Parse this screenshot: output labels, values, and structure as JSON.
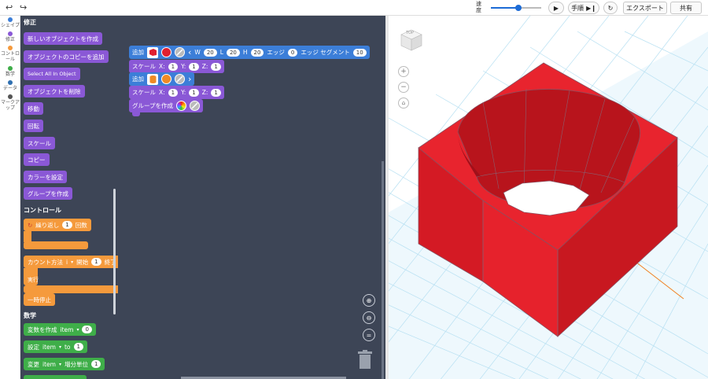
{
  "topbar": {
    "speed_label": "速度",
    "speed_value": 0.55,
    "play_icon": "play-icon",
    "step_label": "手順",
    "export_label": "エクスポート",
    "share_label": "共有"
  },
  "categories": [
    {
      "label": "シェイプ",
      "color": "#3c7ed8"
    },
    {
      "label": "修正",
      "color": "#8a58d6"
    },
    {
      "label": "コントロール",
      "color": "#f59a3c"
    },
    {
      "label": "数学",
      "color": "#3fae49"
    },
    {
      "label": "データ",
      "color": "#2f6fb0"
    },
    {
      "label": "マークアップ",
      "color": "#555555"
    }
  ],
  "palette": {
    "modify_header": "修正",
    "modify_blocks": [
      "新しいオブジェクトを作成",
      "オブジェクトのコピーを追加",
      "Select All In Object",
      "オブジェクトを削除",
      "移動",
      "回転",
      "スケール",
      "コピー",
      "カラーを設定",
      "グループを作成"
    ],
    "control_header": "コントロール",
    "repeat_label": "繰り返し",
    "repeat_count": "1",
    "repeat_unit": "回数",
    "count_label": "カウント方法",
    "count_var": "i",
    "count_start_label": "開始",
    "count_start": "1",
    "count_end_label": "終了",
    "count_do": "実行",
    "pause_label": "一時停止",
    "math_header": "数学",
    "var_create_label": "変数を作成",
    "var_create_name": "item",
    "var_create_value": "0",
    "set_label": "設定",
    "set_var": "item",
    "set_to": "to",
    "set_value": "1",
    "change_label": "変更",
    "change_var": "item",
    "change_unit": "増分単位",
    "change_value": "1"
  },
  "workspace": {
    "block1": {
      "label": "追加",
      "w_label": "W",
      "w": "20",
      "l_label": "L",
      "l": "20",
      "h_label": "H",
      "h": "20",
      "edge_label": "エッジ",
      "edge": "0",
      "seg_label": "エッジ セグメント",
      "seg": "10",
      "color": "#e02030"
    },
    "scale1": {
      "label": "スケール",
      "x_label": "X:",
      "x": "1",
      "y_label": "Y:",
      "y": "1",
      "z_label": "Z:",
      "z": "1"
    },
    "block2": {
      "label": "追加",
      "color": "#f08a24"
    },
    "scale2": {
      "label": "スケール",
      "x_label": "X:",
      "x": "1",
      "y_label": "Y:",
      "y": "1",
      "z_label": "Z:",
      "z": "1"
    },
    "group": {
      "label": "グループを作成"
    }
  },
  "viewcube_label": "TOP",
  "model_color": "#e0202a"
}
